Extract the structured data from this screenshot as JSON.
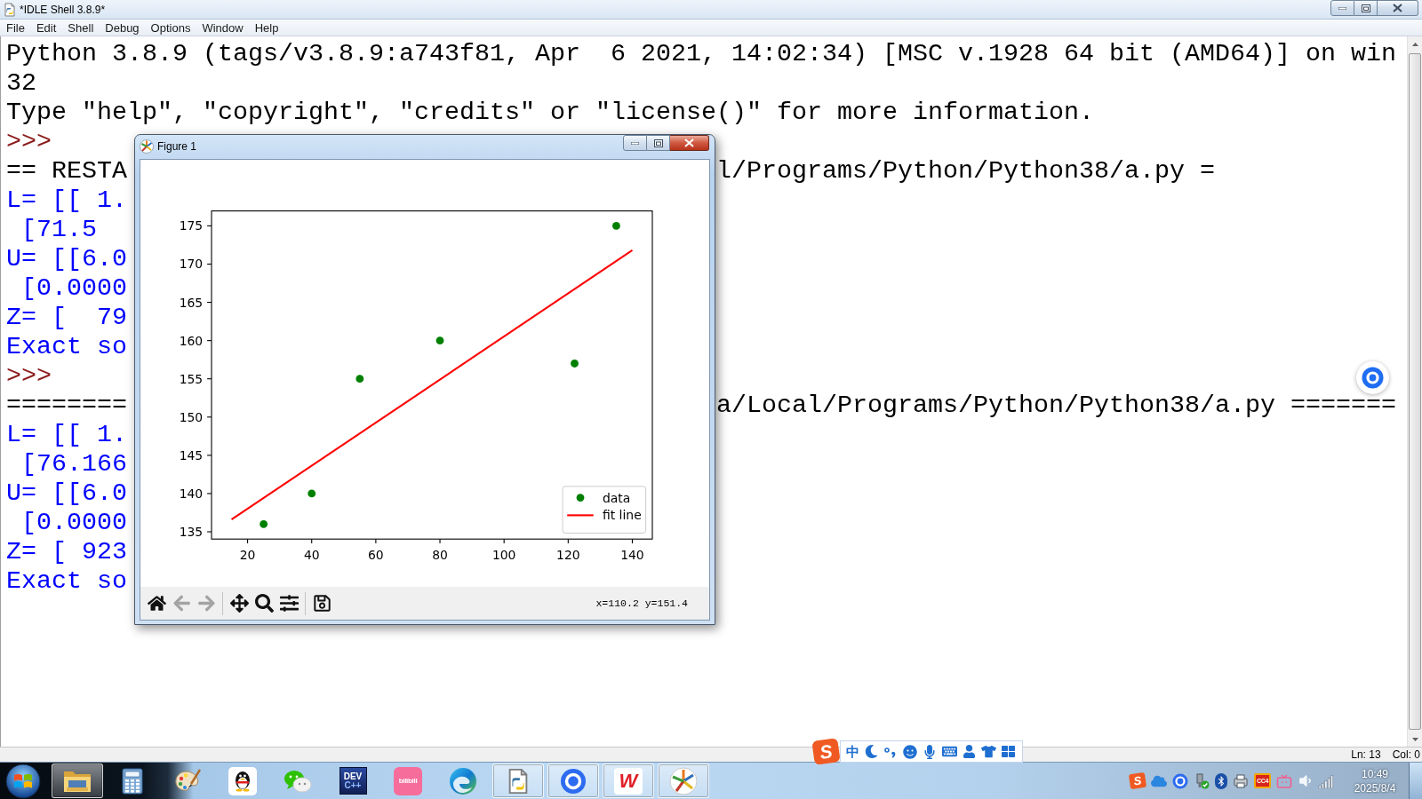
{
  "window": {
    "title": "*IDLE Shell 3.8.9*"
  },
  "menu": [
    "File",
    "Edit",
    "Shell",
    "Debug",
    "Options",
    "Window",
    "Help"
  ],
  "shell": {
    "lines": [
      {
        "kind": "info",
        "text": "Python 3.8.9 (tags/v3.8.9:a743f81, Apr  6 2021, 14:02:34) [MSC v.1928 64 bit (AMD64)] on win"
      },
      {
        "kind": "info",
        "text": "32"
      },
      {
        "kind": "info",
        "text": "Type \"help\", \"copyright\", \"credits\" or \"license()\" for more information."
      },
      {
        "kind": "prompt",
        "text": ">>>"
      },
      {
        "kind": "info",
        "text": "== RESTA",
        "right_text": "l/Programs/Python/Python38/a.py ="
      },
      {
        "kind": "output",
        "text": "L= [[ 1."
      },
      {
        "kind": "output",
        "text": " [71.5"
      },
      {
        "kind": "output",
        "text": "U= [[6.0"
      },
      {
        "kind": "output",
        "text": " [0.0000"
      },
      {
        "kind": "output",
        "text": "Z= [  79"
      },
      {
        "kind": "output",
        "text": "Exact so"
      },
      {
        "kind": "prompt",
        "text": ">>>"
      },
      {
        "kind": "info",
        "text": "========",
        "right_text": "a/Local/Programs/Python/Python38/a.py ======="
      },
      {
        "kind": "output",
        "text": "L= [[ 1."
      },
      {
        "kind": "output",
        "text": " [76.166"
      },
      {
        "kind": "output",
        "text": "U= [[6.0"
      },
      {
        "kind": "output",
        "text": " [0.0000"
      },
      {
        "kind": "output",
        "text": "Z= [ 923"
      },
      {
        "kind": "output",
        "text": "Exact so"
      }
    ]
  },
  "status_bar": {
    "line": "Ln: 13",
    "column": "Col: 0"
  },
  "figure": {
    "title": "Figure 1",
    "chart_data": {
      "type": "scatter",
      "series": [
        {
          "name": "data",
          "type": "scatter",
          "color": "#008000",
          "x": [
            25,
            40,
            55,
            80,
            122,
            135
          ],
          "values": [
            136,
            140,
            155,
            160,
            157,
            175
          ]
        },
        {
          "name": "fit line",
          "type": "line",
          "color": "#ff0000",
          "x": [
            15,
            140
          ],
          "values": [
            136.6,
            171.8
          ]
        }
      ],
      "xlim": [
        8.75,
        146.25
      ],
      "ylim": [
        134.05,
        176.95
      ],
      "xticks": [
        20,
        40,
        60,
        80,
        100,
        120,
        140
      ],
      "yticks": [
        135,
        140,
        145,
        150,
        155,
        160,
        165,
        170,
        175
      ],
      "legend": "lower right"
    },
    "toolbar": {
      "tool_groups": [
        [
          {
            "kind": "home",
            "disabled": false
          },
          {
            "kind": "back",
            "disabled": true
          },
          {
            "kind": "forward",
            "disabled": true
          }
        ],
        [
          {
            "kind": "pan",
            "disabled": false
          },
          {
            "kind": "zoom",
            "disabled": false
          },
          {
            "kind": "subplots",
            "disabled": false
          }
        ],
        [
          {
            "kind": "save",
            "disabled": false
          }
        ]
      ],
      "coordinates": "x=110.2 y=151.4"
    }
  },
  "ime_bar": {
    "logo": "S",
    "mode": "中"
  },
  "taskbar": {
    "apps": [
      {
        "kind": "folder",
        "running": true
      },
      {
        "kind": "calculator",
        "running": false
      },
      {
        "kind": "palette",
        "running": false
      },
      {
        "kind": "penguin",
        "running": false
      },
      {
        "kind": "chat",
        "running": false
      },
      {
        "kind": "dev",
        "running": false,
        "logo_text": [
          "DEV",
          "C++"
        ]
      },
      {
        "kind": "tv",
        "running": false,
        "logo_text": [
          "bilibili"
        ]
      },
      {
        "kind": "swirl",
        "running": false
      },
      {
        "kind": "document",
        "running": true
      },
      {
        "kind": "ring",
        "running": true
      },
      {
        "kind": "wps",
        "running": true,
        "logo_text": [
          "W"
        ]
      },
      {
        "kind": "pinwheel",
        "running": true
      }
    ],
    "tray": {
      "ime_logo": "S",
      "tile_logo": "CC4"
    },
    "clock": {
      "time": "10:49",
      "date": "2025/8/4"
    }
  }
}
